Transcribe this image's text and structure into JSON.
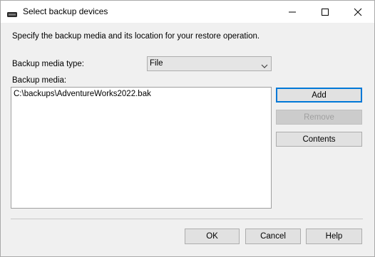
{
  "window": {
    "title": "Select backup devices",
    "icon": "tape-drive-icon",
    "controls": {
      "minimize_icon": "minimize-icon",
      "maximize_icon": "maximize-icon",
      "close_icon": "close-icon"
    }
  },
  "dialog": {
    "description": "Specify the backup media and its location for your restore operation.",
    "media_type": {
      "label": "Backup media type:",
      "selected": "File",
      "arrow_icon": "chevron-down-icon"
    },
    "media_list": {
      "label": "Backup media:",
      "items": [
        "C:\\backups\\AdventureWorks2022.bak"
      ]
    },
    "side_buttons": {
      "add": "Add",
      "remove": "Remove",
      "contents": "Contents"
    },
    "footer_buttons": {
      "ok": "OK",
      "cancel": "Cancel",
      "help": "Help"
    }
  },
  "colors": {
    "window_bg": "#f0f0f0",
    "titlebar_bg": "#ffffff",
    "button_bg": "#e1e1e1",
    "focus_border": "#0078d7",
    "disabled_text": "#a0a0a0"
  }
}
